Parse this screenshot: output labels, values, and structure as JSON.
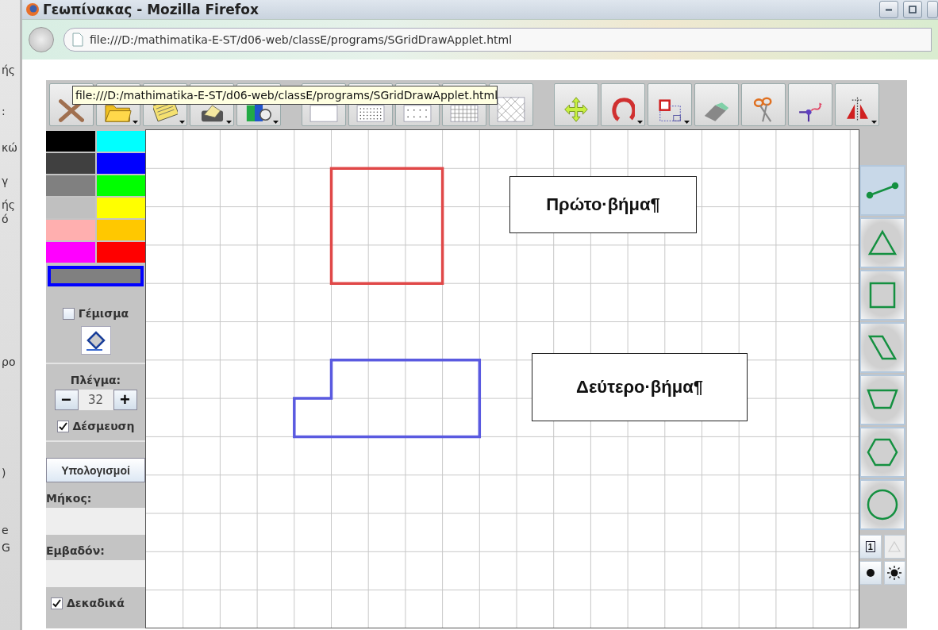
{
  "background_window": {
    "fragments": [
      "ής",
      ":",
      "κώ",
      "γ",
      "ής",
      "ό",
      "ρο",
      ")",
      "e",
      "G"
    ]
  },
  "window": {
    "title": "Γεωπίνακας - Mozilla Firefox"
  },
  "address_bar": {
    "url": "file:///D:/mathimatika-E-ST/d06-web/classE/programs/SGridDrawApplet.html"
  },
  "tooltip": "file:///D:/mathimatika-E-ST/d06-web/classE/programs/SGridDrawApplet.html",
  "toolbar": [
    {
      "kind": "clear"
    },
    {
      "kind": "open"
    },
    {
      "kind": "save"
    },
    {
      "kind": "print"
    },
    {
      "kind": "camera"
    },
    {
      "kind": "gap"
    },
    {
      "kind": "grid-none"
    },
    {
      "kind": "grid-dense"
    },
    {
      "kind": "grid-dots"
    },
    {
      "kind": "grid-square"
    },
    {
      "kind": "grid-lattice"
    },
    {
      "kind": "gap"
    },
    {
      "kind": "move"
    },
    {
      "kind": "rotate"
    },
    {
      "kind": "resize"
    },
    {
      "kind": "eraser"
    },
    {
      "kind": "scissors"
    },
    {
      "kind": "point"
    },
    {
      "kind": "mirror"
    }
  ],
  "palette": [
    {
      "color": "#000000"
    },
    {
      "color": "#00ffff"
    },
    {
      "color": "#404040"
    },
    {
      "color": "#0000ff"
    },
    {
      "color": "#808080"
    },
    {
      "color": "#00ff00"
    },
    {
      "color": "#c0c0c0"
    },
    {
      "color": "#ffff00"
    },
    {
      "color": "#ffafaf"
    },
    {
      "color": "#ffc800"
    },
    {
      "color": "#ff00ff"
    },
    {
      "color": "#ff0000"
    }
  ],
  "fill": {
    "label": "Γέμισμα",
    "checked": false
  },
  "grid": {
    "label": "Πλέγμα:",
    "minus": "−",
    "value": "32",
    "plus": "+"
  },
  "snap": {
    "label": "Δέσμευση",
    "checked": true
  },
  "calc_button": "Υπολογισμοί",
  "length": {
    "label": "Μήκος:"
  },
  "area": {
    "label": "Εμβαδόν:"
  },
  "decimals": {
    "label": "Δεκαδικά",
    "checked": true
  },
  "canvas": {
    "shapes": [
      {
        "kind": "square",
        "color": "#e04848"
      },
      {
        "kind": "step",
        "color": "#5a5ae0"
      }
    ],
    "notes": [
      {
        "text": "Πρώτο·βήμα¶"
      },
      {
        "text": "Δεύτερο·βήμα¶"
      }
    ]
  },
  "shape_tools": [
    {
      "kind": "segment",
      "selected": true
    },
    {
      "kind": "triangle",
      "selected": false
    },
    {
      "kind": "square",
      "selected": false
    },
    {
      "kind": "parallelogram",
      "selected": false
    },
    {
      "kind": "trapezoid",
      "selected": false
    },
    {
      "kind": "hexagon",
      "selected": false
    },
    {
      "kind": "circle",
      "selected": false
    }
  ],
  "small_tools": [
    {
      "kind": "number",
      "label": "1",
      "disabled": false
    },
    {
      "kind": "warning",
      "disabled": true
    },
    {
      "kind": "dot",
      "disabled": false
    },
    {
      "kind": "sun",
      "disabled": false
    }
  ]
}
